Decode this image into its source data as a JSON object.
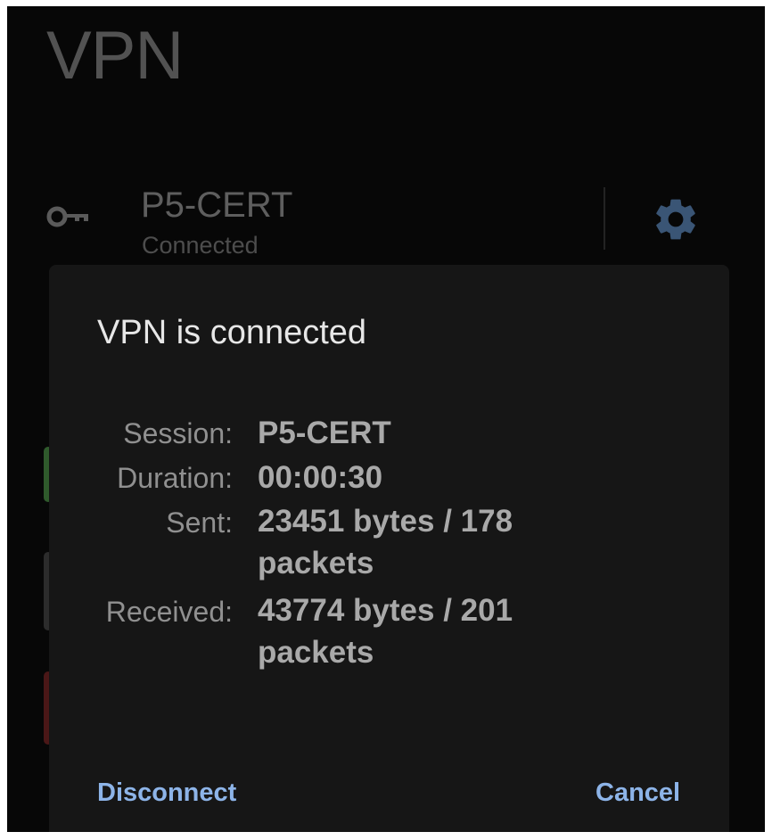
{
  "app": {
    "title": "VPN"
  },
  "profile": {
    "name": "P5-CERT",
    "status": "Connected"
  },
  "dialog": {
    "title": "VPN is connected",
    "stats": [
      {
        "label": "Session:",
        "value": "P5-CERT"
      },
      {
        "label": "Duration:",
        "value": "00:00:30"
      },
      {
        "label": "Sent:",
        "value": "23451 bytes / 178 packets"
      },
      {
        "label": "Received:",
        "value": "43774 bytes / 201 packets"
      }
    ],
    "disconnect_label": "Disconnect",
    "cancel_label": "Cancel"
  },
  "icons": {
    "profile_icon": "key-icon",
    "settings_icon": "gear-icon"
  },
  "colors": {
    "accent": "#8db4e8",
    "background": "#070707",
    "dialog": "#161616"
  }
}
